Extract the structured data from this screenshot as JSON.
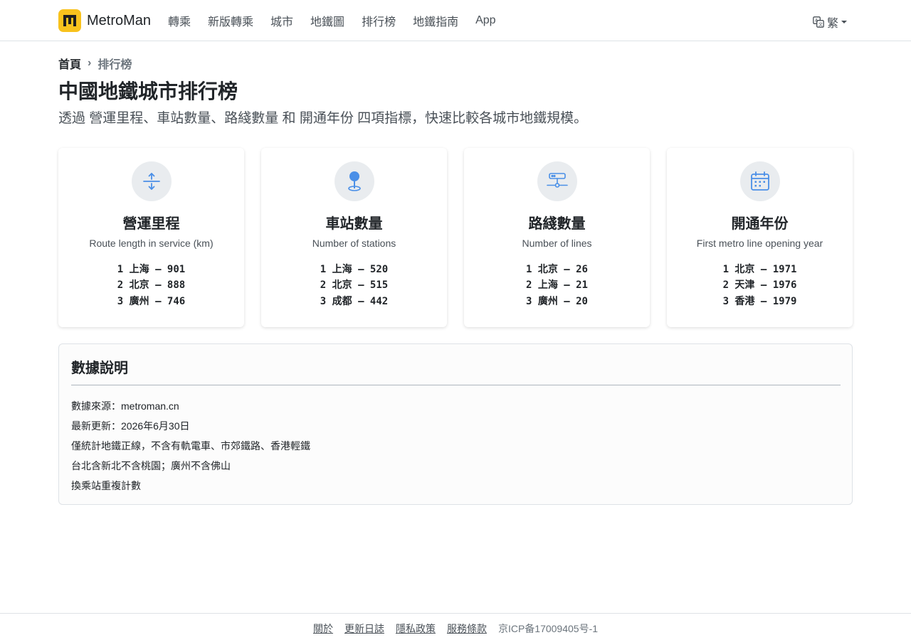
{
  "nav": {
    "brand": "MetroMan",
    "links": [
      "轉乘",
      "新版轉乘",
      "城市",
      "地鐵圖",
      "排行榜",
      "地鐵指南",
      "App"
    ],
    "language": "繁"
  },
  "breadcrumb": {
    "home": "首頁",
    "separator": "›",
    "current": "排行榜"
  },
  "page": {
    "title": "中國地鐵城市排行榜",
    "description": "透過 營運里程、車站數量、路綫數量 和 開通年份 四項指標，快速比較各城市地鐵規模。"
  },
  "cards": [
    {
      "icon": "route-length-icon",
      "title": "營運里程",
      "subtitle": "Route length in service (km)",
      "ranks": [
        "1 上海 – 901",
        "2 北京 – 888",
        "3 廣州 – 746"
      ]
    },
    {
      "icon": "station-pin-icon",
      "title": "車站數量",
      "subtitle": "Number of stations",
      "ranks": [
        "1 上海 – 520",
        "2 北京 – 515",
        "3 成都 – 442"
      ]
    },
    {
      "icon": "lines-network-icon",
      "title": "路綫數量",
      "subtitle": "Number of lines",
      "ranks": [
        "1 北京 – 26",
        "2 上海 – 21",
        "3 廣州 – 20"
      ]
    },
    {
      "icon": "calendar-icon",
      "title": "開通年份",
      "subtitle": "First metro line opening year",
      "ranks": [
        "1 北京 – 1971",
        "2 天津 – 1976",
        "3 香港 – 1979"
      ]
    }
  ],
  "notes": {
    "title": "數據說明",
    "items": [
      "數據來源：metroman.cn",
      "最新更新：2026年6月30日",
      "僅統計地鐵正線，不含有軌電車、市郊鐵路、香港輕鐵",
      "台北含新北不含桃園；廣州不含佛山",
      "換乘站重複計數"
    ]
  },
  "footer": {
    "links": [
      "關於",
      "更新日誌",
      "隱私政策",
      "服務條款"
    ],
    "icp": "京ICP备17009405号-1"
  },
  "colors": {
    "brand_yellow": "#f8c21d",
    "icon_blue": "#4a8fe7",
    "icon_bg": "#e9ecef"
  }
}
